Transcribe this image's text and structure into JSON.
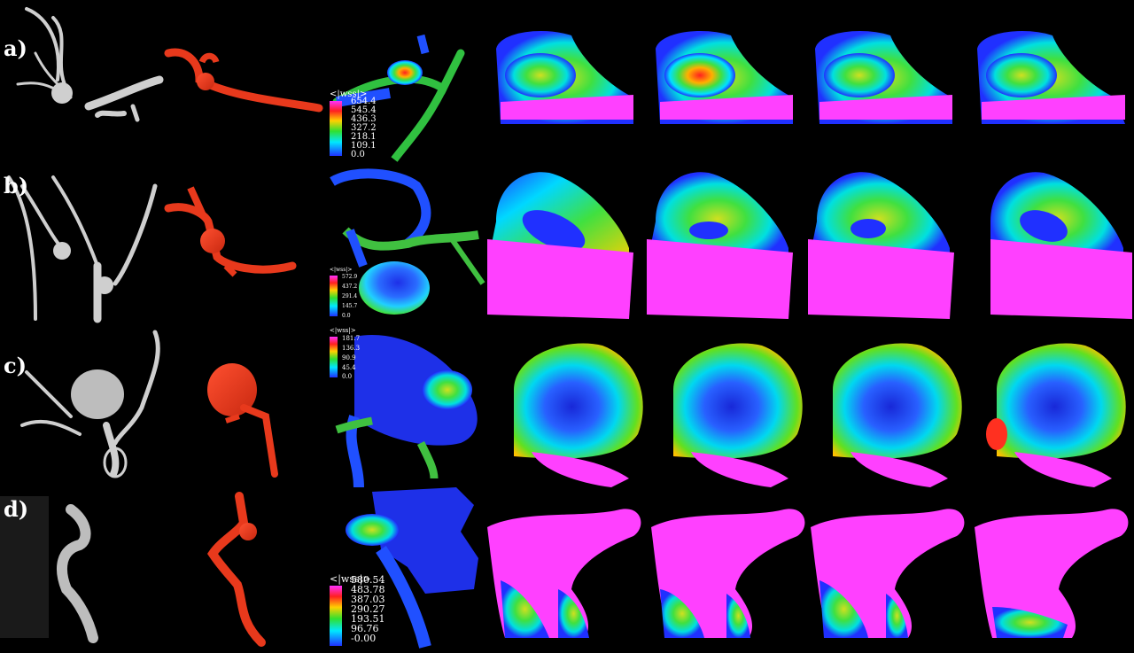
{
  "rows": [
    {
      "label": "a)",
      "legend": {
        "title": "<|wss|>",
        "ticks": [
          "654.4",
          "545.4",
          "436.3",
          "327.2",
          "218.1",
          "109.1",
          "0.0"
        ]
      }
    },
    {
      "label": "b)",
      "legend": {
        "title": "<|wss|>",
        "ticks": [
          "572.9",
          "437.2",
          "291.4",
          "145.7",
          "0.0"
        ]
      }
    },
    {
      "label": "c)",
      "legend": {
        "title": "<|wss|>",
        "ticks": [
          "181.7",
          "136.3",
          "90.9",
          "45.4",
          "0.0"
        ]
      }
    },
    {
      "label": "d)",
      "legend": {
        "title": "<|wss|>",
        "ticks": [
          "580.54",
          "483.78",
          "387.03",
          "290.27",
          "193.51",
          "96.76",
          "-0.00"
        ]
      }
    }
  ],
  "colors": {
    "background": "#000000",
    "vessel_gray": "#cfcfcf",
    "vessel_red": "#e8391c",
    "wss_low": "#2030ff",
    "wss_high": "#ff30ff"
  }
}
